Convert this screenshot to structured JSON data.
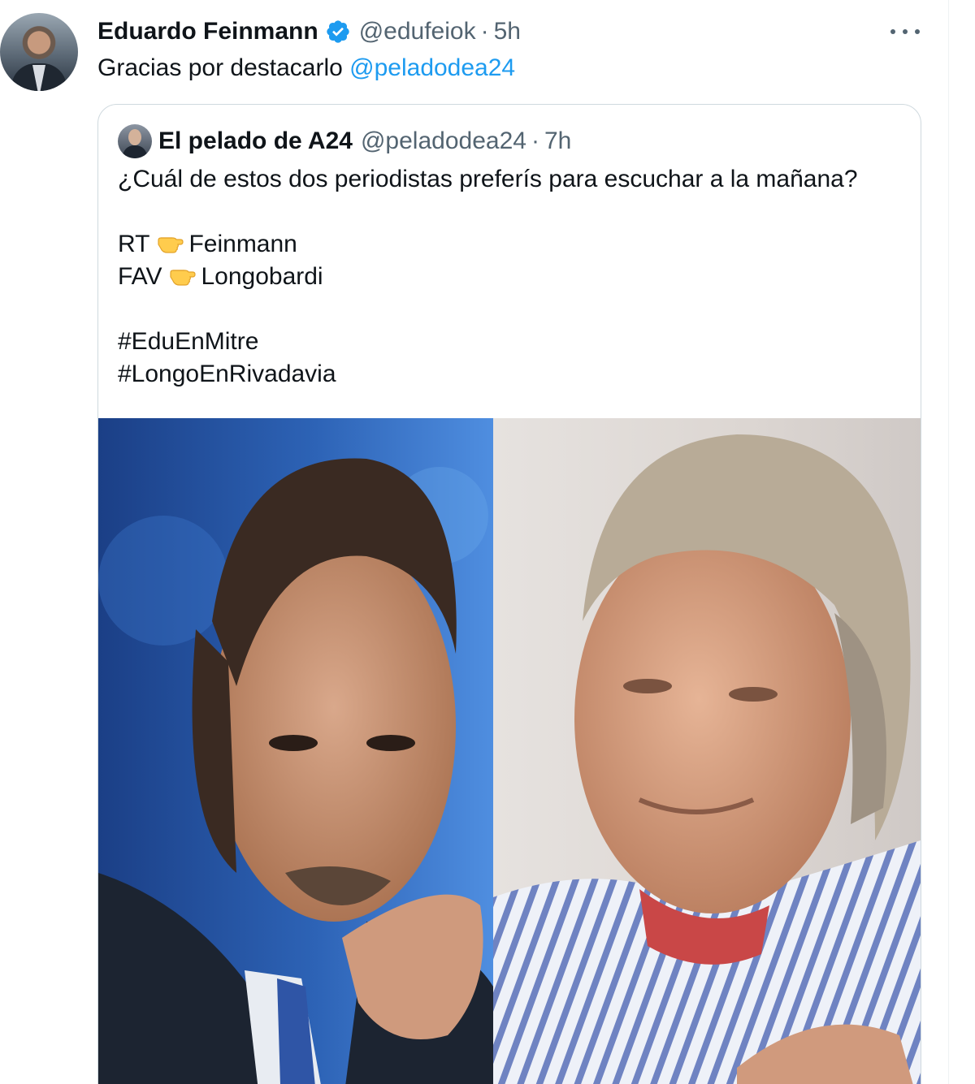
{
  "tweet": {
    "display_name": "Eduardo Feinmann",
    "handle": "@edufeiok",
    "separator": "·",
    "time": "5h",
    "text_prefix": "Gracias por destacarlo ",
    "mention": "@peladodea24",
    "verified_icon": "verified-badge-icon",
    "more_icon": "more-options-icon"
  },
  "quote": {
    "display_name": "El pelado de A24",
    "handle": "@peladodea24",
    "separator": "·",
    "time": "7h",
    "line1": "¿Cuál de estos dos periodistas preferís para escuchar a la mañana?",
    "line2_prefix": "RT",
    "line2_suffix": "Feinmann",
    "line3_prefix": "FAV",
    "line3_suffix": "Longobardi",
    "hashtag1": "#EduEnMitre",
    "hashtag2": "#LongoEnRivadavia",
    "pointing_emoji": "backhand-index-pointing-left-emoji"
  },
  "colors": {
    "text": "#0f1419",
    "secondary": "#536471",
    "link": "#1d9bf0",
    "border": "#cfd9de",
    "verified": "#1d9bf0"
  }
}
